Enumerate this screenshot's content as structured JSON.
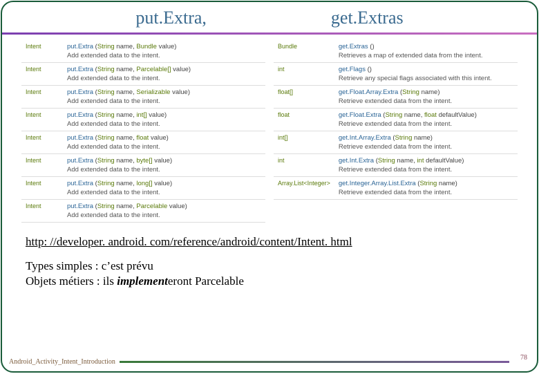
{
  "header": {
    "left": "put.Extra,",
    "right": "get.Extras"
  },
  "left_rows": [
    {
      "ret": "Intent",
      "method": "put.Extra",
      "args": "String name, Bundle value",
      "desc": "Add extended data to the intent."
    },
    {
      "ret": "Intent",
      "method": "put.Extra",
      "args": "String name, Parcelable[] value",
      "desc": "Add extended data to the intent."
    },
    {
      "ret": "Intent",
      "method": "put.Extra",
      "args": "String name, Serializable value",
      "desc": "Add extended data to the intent."
    },
    {
      "ret": "Intent",
      "method": "put.Extra",
      "args": "String name, int[] value",
      "desc": "Add extended data to the intent."
    },
    {
      "ret": "Intent",
      "method": "put.Extra",
      "args": "String name, float value",
      "desc": "Add extended data to the intent."
    },
    {
      "ret": "Intent",
      "method": "put.Extra",
      "args": "String name, byte[] value",
      "desc": "Add extended data to the intent."
    },
    {
      "ret": "Intent",
      "method": "put.Extra",
      "args": "String name, long[] value",
      "desc": "Add extended data to the intent."
    },
    {
      "ret": "Intent",
      "method": "put.Extra",
      "args": "String name, Parcelable value",
      "desc": "Add extended data to the intent."
    }
  ],
  "right_rows": [
    {
      "ret": "Bundle",
      "method": "get.Extras",
      "args": "",
      "desc": "Retrieves a map of extended data from the intent."
    },
    {
      "ret": "int",
      "method": "get.Flags",
      "args": "",
      "desc": "Retrieve any special flags associated with this intent."
    },
    {
      "ret": "float[]",
      "method": "get.Float.Array.Extra",
      "args": "String name",
      "desc": "Retrieve extended data from the intent."
    },
    {
      "ret": "float",
      "method": "get.Float.Extra",
      "args": "String name, float defaultValue",
      "desc": "Retrieve extended data from the intent."
    },
    {
      "ret": "int[]",
      "method": "get.Int.Array.Extra",
      "args": "String name",
      "desc": "Retrieve extended data from the intent."
    },
    {
      "ret": "int",
      "method": "get.Int.Extra",
      "args": "String name, int defaultValue",
      "desc": "Retrieve extended data from the intent."
    },
    {
      "ret": "Array.List<Integer>",
      "method": "get.Integer.Array.List.Extra",
      "args": "String name",
      "desc": "Retrieve extended data from the intent."
    }
  ],
  "link": "http: //developer. android. com/reference/android/content/Intent. html",
  "body": {
    "line1": "Types simples : c’est prévu",
    "line2_a": "Objets métiers : ils ",
    "line2_b": "implement",
    "line2_c": "eront Parcelable"
  },
  "footer": {
    "label": "Android_Activity_Intent_Introduction",
    "page": "78"
  }
}
